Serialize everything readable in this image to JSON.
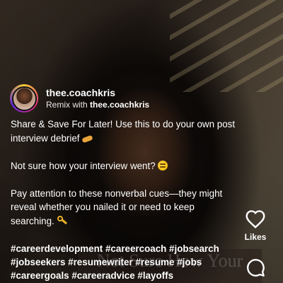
{
  "post": {
    "username": "thee.coachkris",
    "remix_prefix": "Remix with",
    "remix_user": "thee.coachkris"
  },
  "caption": {
    "line1": "Share & Save For Later! Use this to do your own post interview debrief",
    "line1_emoji": "handshake-emoji",
    "line2": "Not sure how your interview went?",
    "line2_emoji": "thinking-face-emoji",
    "line3": "Pay attention to these nonverbal cues—they might reveal whether you nailed it or need to keep searching.",
    "line3_emoji": "key-emoji",
    "hashtags": "#careerdevelopment #careercoach #jobsearch #jobseekers #resumewriter #resume #jobs #careergoals #careeradvice #layoffs"
  },
  "video_overlay": {
    "text": "Not Sure How Your"
  },
  "actions": {
    "likes_label": "Likes",
    "like_icon": "heart-icon",
    "comment_icon": "comment-icon"
  },
  "colors": {
    "text": "#ffffff",
    "avatar_ring": [
      "#f9ce34",
      "#ee2a7b",
      "#6228d7"
    ]
  }
}
